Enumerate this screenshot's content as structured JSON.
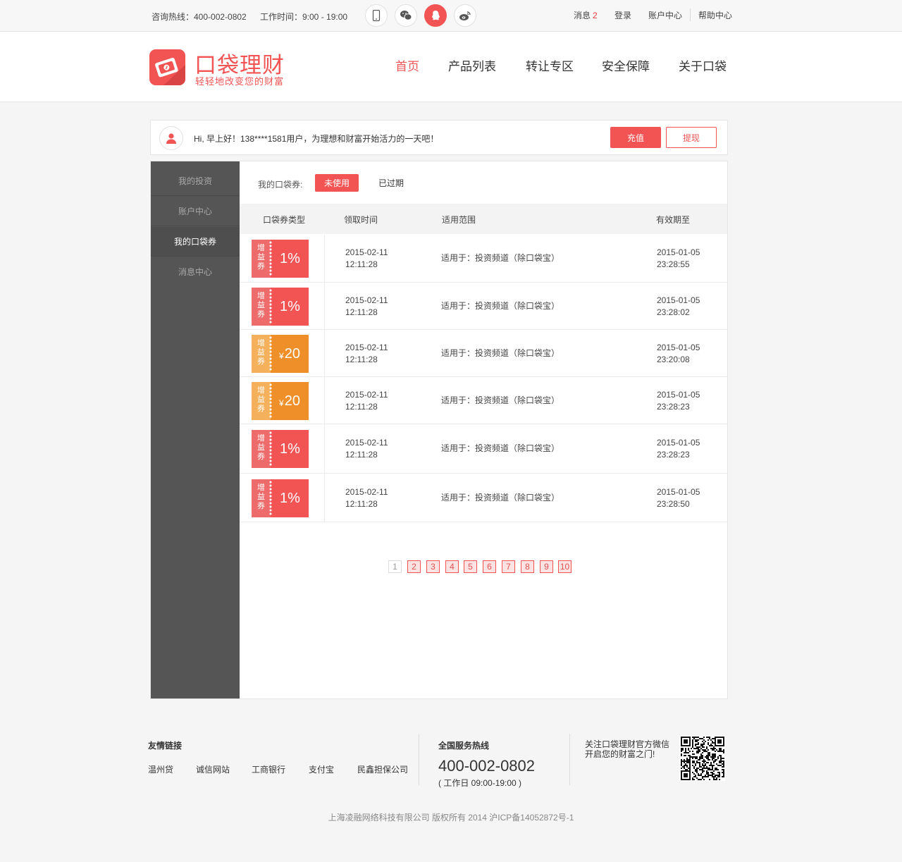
{
  "topbar": {
    "hotline": "咨询热线：400-002-0802",
    "hours": "工作时间：9:00 - 19:00",
    "icons": [
      "phone-icon",
      "wechat-icon",
      "qq-icon",
      "weibo-icon"
    ],
    "messages_label": "消息",
    "messages_count": "2",
    "login": "登录",
    "account": "账户中心",
    "help": "帮助中心"
  },
  "header": {
    "logo_title": "口袋理财",
    "logo_sub": "轻轻地改变您的财富",
    "nav": [
      "首页",
      "产品列表",
      "转让专区",
      "安全保障",
      "关于口袋"
    ],
    "active_nav": "首页"
  },
  "greeting": {
    "text": "Hi, 早上好！138****1581用户，为理想和财富开始活力的一天吧！",
    "recharge": "充值",
    "withdraw": "提现"
  },
  "sidebar": {
    "items": [
      "我的投资",
      "账户中心",
      "我的口袋券",
      "消息中心"
    ],
    "active": "我的口袋券"
  },
  "filter": {
    "label": "我的口袋券:",
    "tab_unused": "未使用",
    "tab_expired": "已过期"
  },
  "table": {
    "headers": [
      "口袋券类型",
      "领取时间",
      "适用范围",
      "有效期至"
    ],
    "coupon_label": [
      "增",
      "益",
      "券"
    ],
    "rows": [
      {
        "type": "red",
        "value": "1%",
        "yen": "",
        "got_date": "2015-02-11",
        "got_time": "12:11:28",
        "scope": "适用于：投资频道（除口袋宝）",
        "exp_date": "2015-01-05",
        "exp_time": "23:28:55"
      },
      {
        "type": "red",
        "value": "1%",
        "yen": "",
        "got_date": "2015-02-11",
        "got_time": "12:11:28",
        "scope": "适用于：投资频道（除口袋宝）",
        "exp_date": "2015-01-05",
        "exp_time": "23:28:02"
      },
      {
        "type": "orange",
        "value": "20",
        "yen": "¥",
        "got_date": "2015-02-11",
        "got_time": "12:11:28",
        "scope": "适用于：投资频道（除口袋宝）",
        "exp_date": "2015-01-05",
        "exp_time": "23:20:08"
      },
      {
        "type": "orange",
        "value": "20",
        "yen": "¥",
        "got_date": "2015-02-11",
        "got_time": "12:11:28",
        "scope": "适用于：投资频道（除口袋宝）",
        "exp_date": "2015-01-05",
        "exp_time": "23:28:23"
      },
      {
        "type": "red",
        "value": "1%",
        "yen": "",
        "got_date": "2015-02-11",
        "got_time": "12:11:28",
        "scope": "适用于：投资频道（除口袋宝）",
        "exp_date": "2015-01-05",
        "exp_time": "23:28:23"
      },
      {
        "type": "red",
        "value": "1%",
        "yen": "",
        "got_date": "2015-02-11",
        "got_time": "12:11:28",
        "scope": "适用于：投资频道（除口袋宝）",
        "exp_date": "2015-01-05",
        "exp_time": "23:28:50"
      }
    ]
  },
  "pagination": {
    "pages": [
      "1",
      "2",
      "3",
      "4",
      "5",
      "6",
      "7",
      "8",
      "9",
      "10"
    ],
    "current": "1"
  },
  "footer": {
    "links_title": "友情链接",
    "links": [
      "温州贷",
      "诚信网站",
      "工商银行",
      "支付宝",
      "民鑫担保公司"
    ],
    "hotline_title": "全国服务热线",
    "hotline": "400-002-0802",
    "hotline_hours": "( 工作日 09:00-19:00 )",
    "follow_line1": "关注口袋理财官方微信",
    "follow_line2": "开启您的财富之门!",
    "copyright": "上海凌融网络科技有限公司   版权所有   2014   沪ICP备14052872号-1"
  },
  "colors": {
    "accent": "#f25353",
    "orange": "#ee8f2a",
    "sidebar": "#555555"
  }
}
